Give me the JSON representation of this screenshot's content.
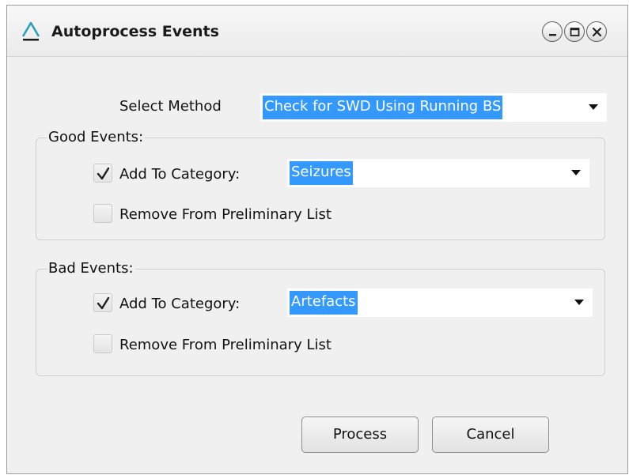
{
  "window": {
    "title": "Autoprocess Events",
    "icon": "app-logo-icon"
  },
  "method": {
    "label": "Select Method",
    "selected": "Check for SWD Using Running BS"
  },
  "good_events": {
    "title": "Good Events:",
    "add_label": "Add To Category:",
    "add_checked": true,
    "category": "Seizures",
    "remove_label": "Remove From Preliminary List",
    "remove_checked": false
  },
  "bad_events": {
    "title": "Bad Events:",
    "add_label": "Add To Category:",
    "add_checked": true,
    "category": "Artefacts",
    "remove_label": "Remove From Preliminary List",
    "remove_checked": false
  },
  "buttons": {
    "process": "Process",
    "cancel": "Cancel"
  },
  "colors": {
    "selection": "#3399ff",
    "logo_accent": "#2aa0b8"
  }
}
